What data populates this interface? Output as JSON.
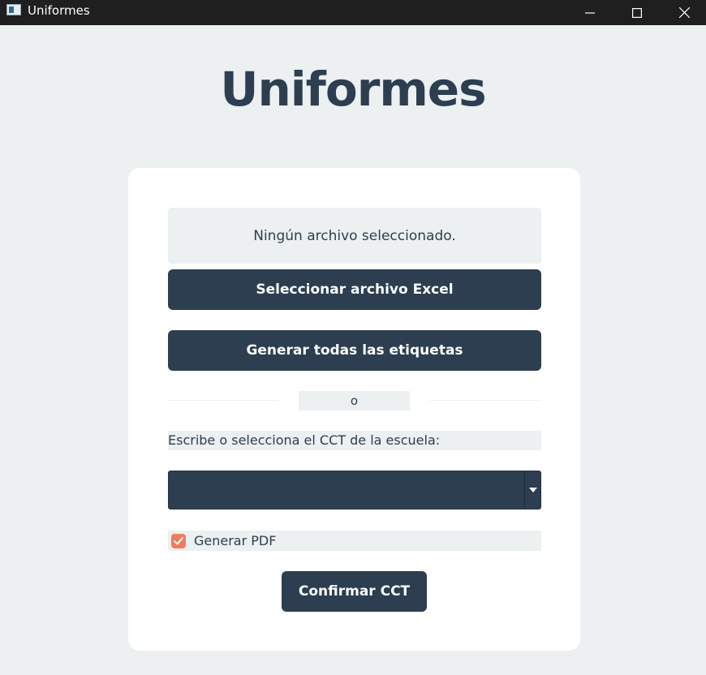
{
  "window": {
    "title": "Uniformes",
    "icons": {
      "app": "app-window-icon",
      "minimize": "minimize-icon",
      "maximize": "maximize-icon",
      "close": "close-icon"
    }
  },
  "header": {
    "title": "Uniformes"
  },
  "file": {
    "status": "Ningún archivo seleccionado.",
    "select_button": "Seleccionar archivo Excel"
  },
  "generate": {
    "all_button": "Generar todas las etiquetas"
  },
  "divider": {
    "label": "o"
  },
  "cct": {
    "label": "Escribe o selecciona el CCT de la escuela:",
    "value": "",
    "dropdown_icon": "chevron-down-icon"
  },
  "pdf": {
    "label": "Generar PDF",
    "checked": true
  },
  "confirm": {
    "button": "Confirmar CCT"
  },
  "colors": {
    "background": "#ecf0f1",
    "primary": "#2c3e50",
    "accent": "#f07b5f",
    "card": "#ffffff"
  }
}
